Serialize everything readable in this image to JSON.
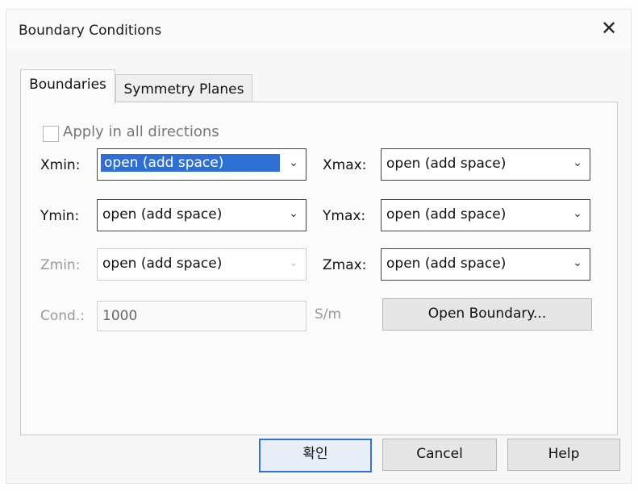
{
  "dialog": {
    "title": "Boundary Conditions",
    "close_glyph": "✕"
  },
  "tabs": [
    {
      "label": "Boundaries",
      "active": true
    },
    {
      "label": "Symmetry Planes",
      "active": false
    }
  ],
  "apply_all": {
    "label": "Apply in all directions",
    "checked": false,
    "enabled": false
  },
  "fields": {
    "xmin": {
      "label": "Xmin:",
      "value": "open (add space)"
    },
    "xmax": {
      "label": "Xmax:",
      "value": "open (add space)"
    },
    "ymin": {
      "label": "Ymin:",
      "value": "open (add space)"
    },
    "ymax": {
      "label": "Ymax:",
      "value": "open (add space)"
    },
    "zmin": {
      "label": "Zmin:",
      "value": "open (add space)"
    },
    "zmax": {
      "label": "Zmax:",
      "value": "open (add space)"
    }
  },
  "cond": {
    "label": "Cond.:",
    "value": "1000",
    "unit": "S/m"
  },
  "buttons": {
    "open_boundary": "Open Boundary...",
    "ok": "확인",
    "cancel": "Cancel",
    "help": "Help"
  },
  "icons": {
    "dropdown": "chevron-down-icon",
    "close": "close-icon"
  },
  "colors": {
    "selection": "#2d6fd2",
    "default_button_border": "#2f74d0"
  }
}
